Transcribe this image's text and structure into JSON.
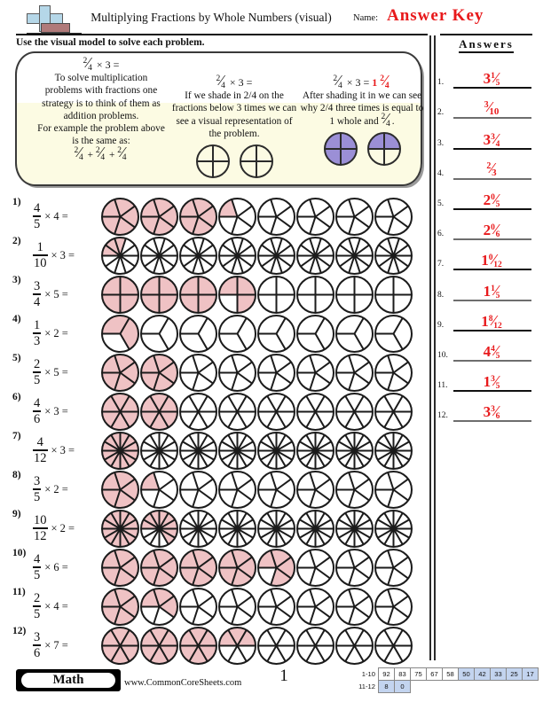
{
  "header": {
    "title": "Multiplying Fractions by Whole Numbers (visual)",
    "name_label": "Name:",
    "answer_key": "Answer Key",
    "logo_icon": "plus-block-logo"
  },
  "directions": "Use the visual model to solve each problem.",
  "example": {
    "columns": [
      {
        "heading_num": "2",
        "heading_den": "4",
        "heading_rest": "× 3 =",
        "body": "To solve multiplication problems with fractions one strategy is to think of them as addition problems.",
        "body2": "For example the problem above is the same as:",
        "sum": "2/4 + 2/4 + 2/4",
        "circles": []
      },
      {
        "heading_num": "2",
        "heading_den": "4",
        "heading_rest": "× 3 =",
        "body": "If we shade in 2/4 on the fractions below 3 times we can see a visual representation of the problem.",
        "circles": [
          {
            "slices": 4,
            "shaded": 0
          },
          {
            "slices": 4,
            "shaded": 0
          }
        ]
      },
      {
        "heading_num": "2",
        "heading_den": "4",
        "heading_rest": "× 3 =",
        "answer_whole": "1",
        "answer_num": "2",
        "answer_den": "4",
        "body": "After shading it in we can see why 2/4 three times is equal to 1 whole and",
        "body_frac_num": "2",
        "body_frac_den": "4",
        "circles": [
          {
            "slices": 4,
            "shaded": 4
          },
          {
            "slices": 4,
            "shaded": 2
          }
        ]
      }
    ]
  },
  "colors": {
    "shade_pink": "#efc2c4",
    "shade_purple": "#9b8fd6",
    "answer_red": "#e8191b",
    "example_bg": "#fcfbe3",
    "score_highlight": "#c3d4ef"
  },
  "problems": [
    {
      "n": "1)",
      "num": "4",
      "den": "5",
      "mult": "× 4 =",
      "circles": 8,
      "slices": 5,
      "shaded_units": 16
    },
    {
      "n": "2)",
      "num": "1",
      "den": "10",
      "mult": "× 3 =",
      "circles": 8,
      "slices": 10,
      "shaded_units": 3
    },
    {
      "n": "3)",
      "num": "3",
      "den": "4",
      "mult": "× 5 =",
      "circles": 8,
      "slices": 4,
      "shaded_units": 15
    },
    {
      "n": "4)",
      "num": "1",
      "den": "3",
      "mult": "× 2 =",
      "circles": 8,
      "slices": 3,
      "shaded_units": 2
    },
    {
      "n": "5)",
      "num": "2",
      "den": "5",
      "mult": "× 5 =",
      "circles": 8,
      "slices": 5,
      "shaded_units": 10
    },
    {
      "n": "6)",
      "num": "4",
      "den": "6",
      "mult": "× 3 =",
      "circles": 8,
      "slices": 6,
      "shaded_units": 12
    },
    {
      "n": "7)",
      "num": "4",
      "den": "12",
      "mult": "× 3 =",
      "circles": 8,
      "slices": 12,
      "shaded_units": 12
    },
    {
      "n": "8)",
      "num": "3",
      "den": "5",
      "mult": "× 2 =",
      "circles": 8,
      "slices": 5,
      "shaded_units": 6
    },
    {
      "n": "9)",
      "num": "10",
      "den": "12",
      "mult": "× 2 =",
      "circles": 8,
      "slices": 12,
      "shaded_units": 20
    },
    {
      "n": "10)",
      "num": "4",
      "den": "5",
      "mult": "× 6 =",
      "circles": 8,
      "slices": 5,
      "shaded_units": 24
    },
    {
      "n": "11)",
      "num": "2",
      "den": "5",
      "mult": "× 4 =",
      "circles": 8,
      "slices": 5,
      "shaded_units": 8
    },
    {
      "n": "12)",
      "num": "3",
      "den": "6",
      "mult": "× 7 =",
      "circles": 8,
      "slices": 6,
      "shaded_units": 21
    }
  ],
  "answers": {
    "title": "Answers",
    "items": [
      {
        "idx": "1.",
        "whole": "3",
        "num": "1",
        "den": "5",
        "line": "black"
      },
      {
        "idx": "2.",
        "whole": "",
        "num": "3",
        "den": "10",
        "line": "grey"
      },
      {
        "idx": "3.",
        "whole": "3",
        "num": "3",
        "den": "4",
        "line": "black"
      },
      {
        "idx": "4.",
        "whole": "",
        "num": "2",
        "den": "3",
        "line": "grey"
      },
      {
        "idx": "5.",
        "whole": "2",
        "num": "0",
        "den": "5",
        "line": "black"
      },
      {
        "idx": "6.",
        "whole": "2",
        "num": "0",
        "den": "6",
        "line": "grey"
      },
      {
        "idx": "7.",
        "whole": "1",
        "num": "0",
        "den": "12",
        "line": "black"
      },
      {
        "idx": "8.",
        "whole": "1",
        "num": "1",
        "den": "5",
        "line": "grey"
      },
      {
        "idx": "9.",
        "whole": "1",
        "num": "8",
        "den": "12",
        "line": "black"
      },
      {
        "idx": "10.",
        "whole": "4",
        "num": "4",
        "den": "5",
        "line": "grey"
      },
      {
        "idx": "11.",
        "whole": "1",
        "num": "3",
        "den": "5",
        "line": "black"
      },
      {
        "idx": "12.",
        "whole": "3",
        "num": "3",
        "den": "6",
        "line": "grey"
      }
    ]
  },
  "footer": {
    "subject": "Math",
    "website": "www.CommonCoreSheets.com",
    "page_number": "1",
    "score_rows": [
      {
        "label": "1-10",
        "values": [
          "92",
          "83",
          "75",
          "67",
          "58",
          "50",
          "42",
          "33",
          "25",
          "17"
        ],
        "highlight": [
          false,
          false,
          false,
          false,
          false,
          true,
          true,
          true,
          true,
          true
        ]
      },
      {
        "label": "11-12",
        "values": [
          "8",
          "0"
        ],
        "highlight": [
          true,
          true
        ]
      }
    ]
  }
}
